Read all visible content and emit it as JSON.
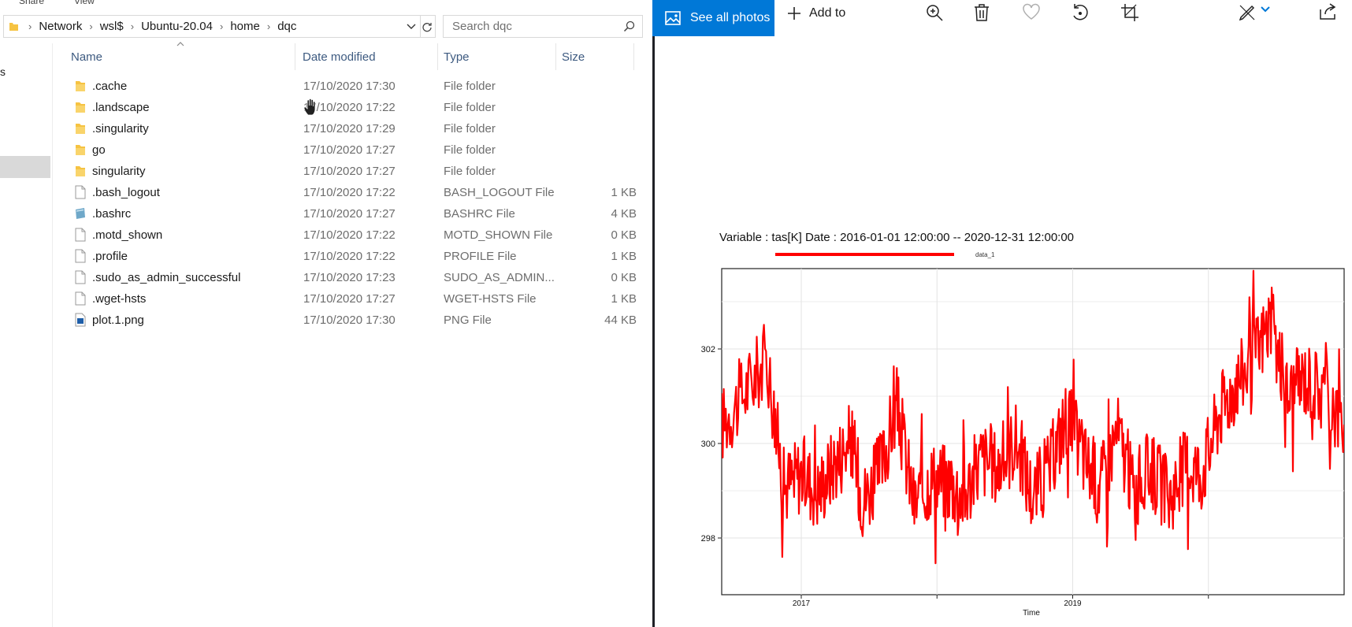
{
  "explorer": {
    "ribbon": {
      "share": "Share",
      "view": "View"
    },
    "breadcrumb": [
      "Network",
      "wsl$",
      "Ubuntu-20.04",
      "home",
      "dqc"
    ],
    "search": {
      "placeholder": "Search dqc"
    },
    "nav_fragment": "s",
    "columns": {
      "name": "Name",
      "date": "Date modified",
      "type": "Type",
      "size": "Size"
    },
    "files": [
      {
        "name": ".cache",
        "date": "17/10/2020 17:30",
        "type": "File folder",
        "size": "",
        "icon": "folder-icon"
      },
      {
        "name": ".landscape",
        "date": "17/10/2020 17:22",
        "type": "File folder",
        "size": "",
        "icon": "folder-icon"
      },
      {
        "name": ".singularity",
        "date": "17/10/2020 17:29",
        "type": "File folder",
        "size": "",
        "icon": "folder-icon"
      },
      {
        "name": "go",
        "date": "17/10/2020 17:27",
        "type": "File folder",
        "size": "",
        "icon": "folder-icon"
      },
      {
        "name": "singularity",
        "date": "17/10/2020 17:27",
        "type": "File folder",
        "size": "",
        "icon": "folder-icon"
      },
      {
        "name": ".bash_logout",
        "date": "17/10/2020 17:22",
        "type": "BASH_LOGOUT File",
        "size": "1 KB",
        "icon": "file-icon"
      },
      {
        "name": ".bashrc",
        "date": "17/10/2020 17:27",
        "type": "BASHRC File",
        "size": "4 KB",
        "icon": "bashrc-file-icon"
      },
      {
        "name": ".motd_shown",
        "date": "17/10/2020 17:22",
        "type": "MOTD_SHOWN File",
        "size": "0 KB",
        "icon": "file-icon"
      },
      {
        "name": ".profile",
        "date": "17/10/2020 17:22",
        "type": "PROFILE File",
        "size": "1 KB",
        "icon": "file-icon"
      },
      {
        "name": ".sudo_as_admin_successful",
        "date": "17/10/2020 17:23",
        "type": "SUDO_AS_ADMIN...",
        "size": "0 KB",
        "icon": "file-icon"
      },
      {
        "name": ".wget-hsts",
        "date": "17/10/2020 17:27",
        "type": "WGET-HSTS File",
        "size": "1 KB",
        "icon": "file-icon"
      },
      {
        "name": "plot.1.png",
        "date": "17/10/2020 17:30",
        "type": "PNG File",
        "size": "44 KB",
        "icon": "image-file-icon"
      }
    ]
  },
  "photos": {
    "see_all": "See all photos",
    "add_to": "Add to",
    "toolbar_icons": [
      "zoom-in-icon",
      "delete-icon",
      "favorite-icon",
      "rotate-icon",
      "crop-icon",
      "edit-icon",
      "share-icon"
    ]
  },
  "colors": {
    "accent": "#0078d7",
    "series": "#ff0000",
    "folder": "#f6c342",
    "header_text": "#3d5a80"
  },
  "chart_data": {
    "type": "line",
    "title": "Variable : tas[K]  Date :  2016-01-01 12:00:00 -- 2020-12-31 12:00:00",
    "xlabel": "Time",
    "ylabel": "",
    "x_ticks": [
      "2017",
      "2019"
    ],
    "y_ticks": [
      298,
      300,
      302
    ],
    "xlim": [
      "2016-06-01",
      "2020-12-31"
    ],
    "ylim": [
      296.8,
      303.7
    ],
    "grid": true,
    "legend": "top",
    "series": [
      {
        "name": "data_1",
        "color": "#ff0000",
        "x": [
          "2016-06-01",
          "2016-08-01",
          "2016-10-01",
          "2016-11-15",
          "2017-01-01",
          "2017-02-15",
          "2017-04-01",
          "2017-05-15",
          "2017-06-15",
          "2017-08-01",
          "2017-09-15",
          "2017-11-01",
          "2017-12-15",
          "2018-02-01",
          "2018-03-15",
          "2018-05-01",
          "2018-06-15",
          "2018-08-01",
          "2018-09-15",
          "2018-11-01",
          "2018-12-15",
          "2019-02-01",
          "2019-03-15",
          "2019-05-01",
          "2019-06-15",
          "2019-08-01",
          "2019-09-15",
          "2019-11-01",
          "2019-12-15",
          "2020-02-01",
          "2020-03-15",
          "2020-05-01",
          "2020-06-15",
          "2020-08-01",
          "2020-09-15",
          "2020-11-01",
          "2020-12-31"
        ],
        "y": [
          300.4,
          301.1,
          301.8,
          299.1,
          299.4,
          299.0,
          299.6,
          300.1,
          298.8,
          299.4,
          300.8,
          298.7,
          299.3,
          299.2,
          298.9,
          299.7,
          299.5,
          300.1,
          298.9,
          299.5,
          300.6,
          299.7,
          299.1,
          300.3,
          299.0,
          299.5,
          298.8,
          299.6,
          299.4,
          300.7,
          301.3,
          301.8,
          302.6,
          301.0,
          301.4,
          301.2,
          300.4
        ]
      }
    ]
  }
}
